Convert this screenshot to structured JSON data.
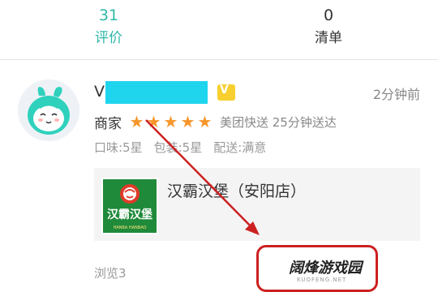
{
  "tabs": [
    {
      "count": "31",
      "label": "评价"
    },
    {
      "count": "0",
      "label": "清单"
    }
  ],
  "review": {
    "username_visible": "V",
    "vip_badge": "V",
    "time": "2分钟前",
    "merchant_label": "商家",
    "merchant_rating_stars": 5,
    "delivery_info": "美团快送 25分钟送达",
    "ratings": [
      "口味:5星",
      "包装:5星",
      "配送:满意"
    ],
    "shop": {
      "name": "汉霸汉堡（安阳店）",
      "logo_text": "汉霸汉堡",
      "logo_subtext": "HANBA HANBAO"
    },
    "views": "浏览3"
  },
  "watermark": {
    "text": "阔烽游戏园",
    "subtext": "KUOFENG.NET"
  },
  "colors": {
    "accent": "#2fb8aa",
    "star": "#f7962a",
    "annotation": "#cc2020",
    "name_mask": "#1fd5ee"
  }
}
